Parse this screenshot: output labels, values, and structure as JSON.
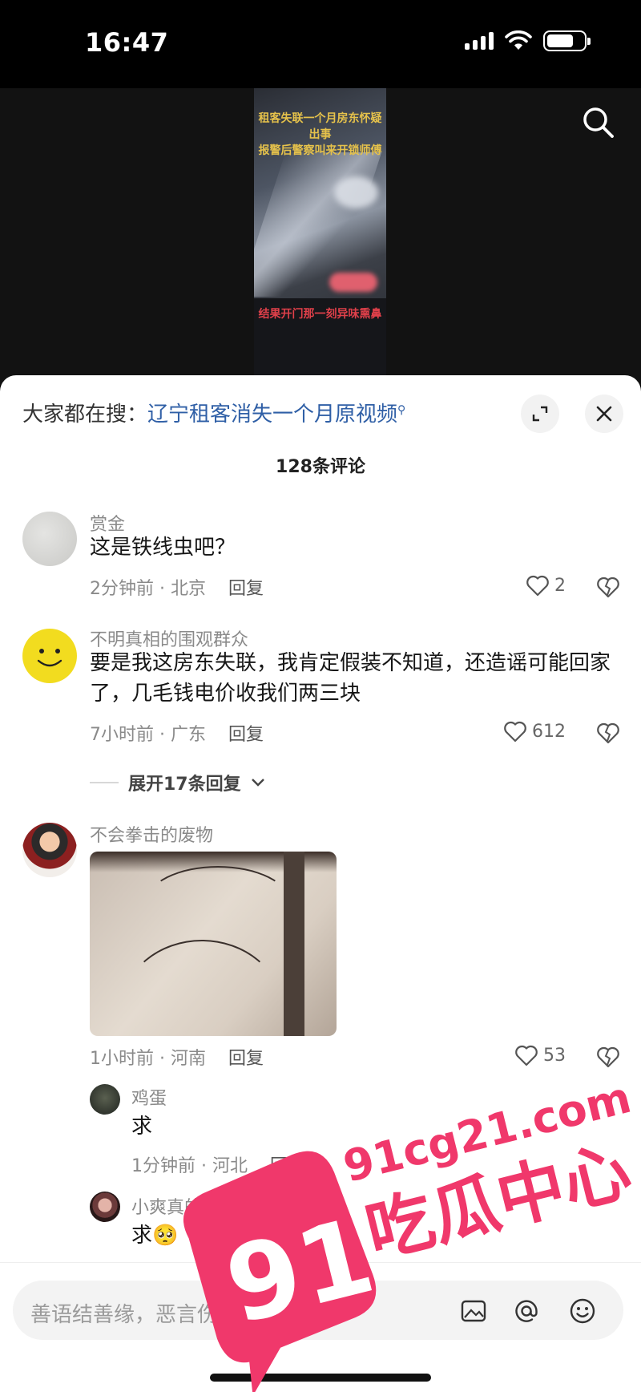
{
  "status_bar": {
    "time": "16:47"
  },
  "video": {
    "caption_top": "租客失联一个月房东怀疑出事\n报警后警察叫来开锁师傅",
    "caption_bottom": "结果开门那一刻异味熏鼻"
  },
  "sheet": {
    "trending_prefix": "大家都在搜：",
    "trending_link": "辽宁租客消失一个月原视频",
    "comment_count": "128条评论"
  },
  "comments": [
    {
      "user": "赏金",
      "text": "这是铁线虫吧？",
      "time_location": "2分钟前 · 北京",
      "reply_label": "回复",
      "likes": "2"
    },
    {
      "user": "不明真相的围观群众",
      "text": "要是我这房东失联，我肯定假装不知道，还造谣可能回家了，几毛钱电价收我们两三块",
      "time_location": "7小时前 · 广东",
      "reply_label": "回复",
      "likes": "612",
      "expand_label": "展开17条回复"
    },
    {
      "user": "不会拳击的废物",
      "time_location": "1小时前 · 河南",
      "reply_label": "回复",
      "likes": "53",
      "replies": [
        {
          "user": "鸡蛋",
          "text": "求",
          "time_location": "1分钟前 · 河北",
          "reply_label": "回复"
        },
        {
          "user": "小爽真的没喝多.",
          "text": "求🥺"
        }
      ]
    }
  ],
  "input": {
    "placeholder": "善语结善缘，恶言伤人心"
  },
  "watermark": {
    "logo_number": "91",
    "site": "91cg21.com",
    "site_name": "吃瓜中心"
  },
  "colors": {
    "link": "#2f5fa6",
    "watermark_pink": "#f0386b",
    "sheet_bg": "#ffffff"
  }
}
